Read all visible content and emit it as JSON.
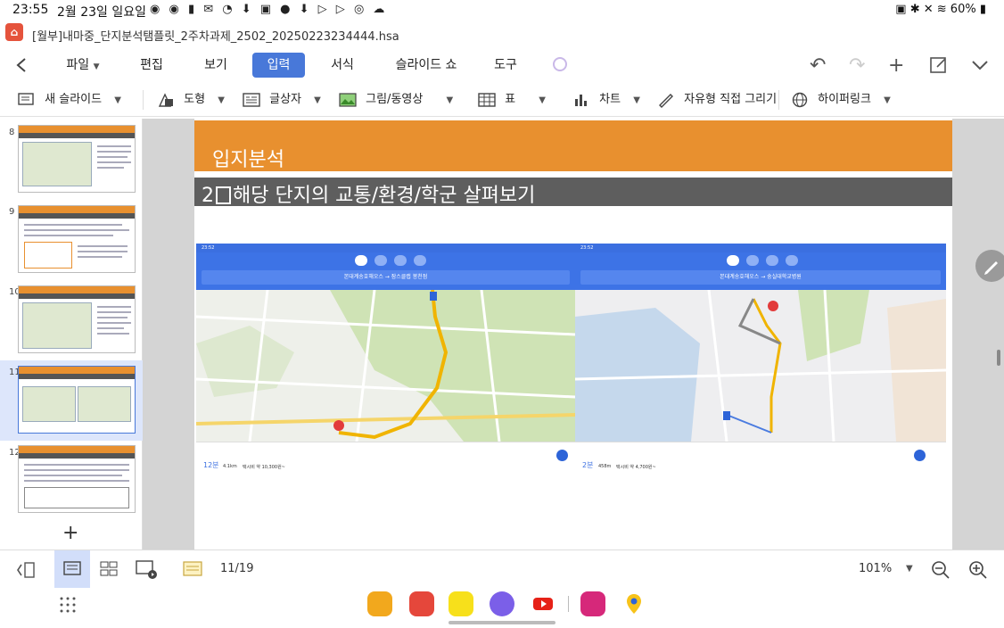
{
  "status_bar": {
    "time": "23:55",
    "date": "2월 23일 일요일",
    "battery": "60%"
  },
  "title_bar": {
    "document_title": "[월부]내마중_단지분석탬플릿_2주차과제_2502_20250223234444.hsa"
  },
  "menu": {
    "items": [
      "파일",
      "편집",
      "보기",
      "입력",
      "서식",
      "슬라이드 쇼",
      "도구"
    ],
    "active": "입력"
  },
  "toolbar": {
    "new_slide": "새 슬라이드",
    "shape": "도형",
    "textbox": "글상자",
    "picture": "그림/동영상",
    "table": "표",
    "chart": "차트",
    "freeform": "자유형 직접 그리기",
    "hyperlink": "하이퍼링크"
  },
  "slide_panel": {
    "numbers": [
      "8",
      "9",
      "10",
      "11",
      "12"
    ],
    "selected": "11"
  },
  "slide": {
    "header": "입지분석",
    "subtitle_prefix": "2",
    "subtitle": "해당 단지의 교통/환경/학군 살펴보기",
    "map_left": {
      "status_time": "23:52",
      "route": "본대계송호해오스 → 잠스클랩 봉천점",
      "duration": "12분",
      "distance": "4.1km",
      "fare": "택시비 약 10,300원~"
    },
    "map_right": {
      "status_time": "23:52",
      "route": "본대계송호해오스 → 숭실대학교병원",
      "duration": "2분",
      "distance": "458m",
      "fare": "택시비 약 4,700원~"
    }
  },
  "bottom_bar": {
    "page_counter": "11/19",
    "zoom": "101%"
  },
  "colors": {
    "accent_blue": "#4878d9",
    "slide_orange": "#e8902f",
    "slide_gray": "#5e5e5e"
  }
}
